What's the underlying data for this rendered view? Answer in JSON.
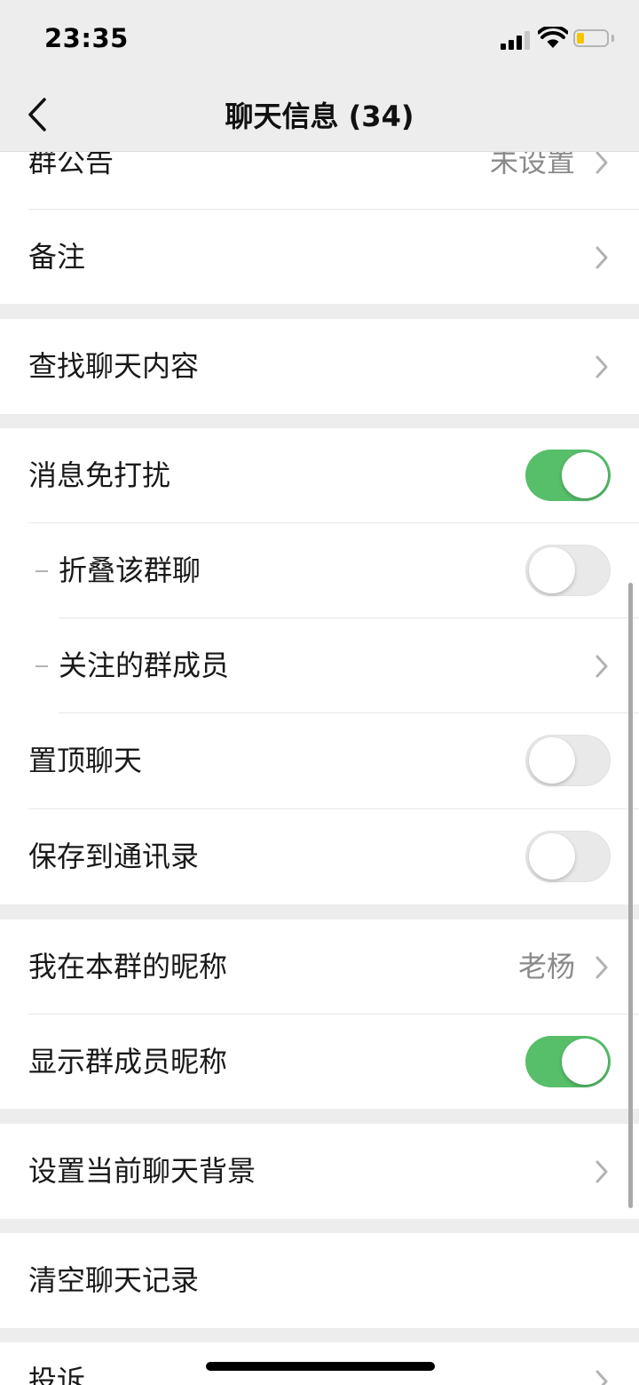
{
  "status_bar": {
    "time": "23:35",
    "battery_level": 0.25
  },
  "nav": {
    "title": "聊天信息 (34)",
    "back_icon": "chevron-left-icon"
  },
  "settings": {
    "announcement": {
      "label": "群公告",
      "value": "未设置"
    },
    "remark": {
      "label": "备注"
    },
    "search_history": {
      "label": "查找聊天内容"
    },
    "mute": {
      "label": "消息免打扰",
      "on": true
    },
    "fold_group": {
      "label": "折叠该群聊",
      "on": false
    },
    "followed_members": {
      "label": "关注的群成员"
    },
    "pin_chat": {
      "label": "置顶聊天",
      "on": false
    },
    "save_contacts": {
      "label": "保存到通讯录",
      "on": false
    },
    "my_nickname": {
      "label": "我在本群的昵称",
      "value": "老杨"
    },
    "show_nicknames": {
      "label": "显示群成员昵称",
      "on": true
    },
    "set_background": {
      "label": "设置当前聊天背景"
    },
    "clear_history": {
      "label": "清空聊天记录"
    },
    "complaint": {
      "label": "投诉"
    }
  },
  "colors": {
    "toggle_on": "#57be6a",
    "toggle_off": "#e9e9e9",
    "background": "#ededed"
  }
}
